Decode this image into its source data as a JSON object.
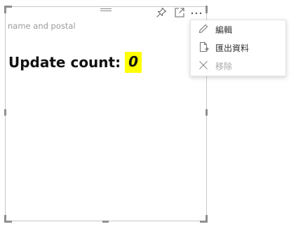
{
  "visual": {
    "title": "name and postal",
    "count_label": "Update count:",
    "count_value": "0",
    "highlight_color": "#ffff00"
  },
  "header_icons": [
    "drag-grip-icon",
    "pin-icon",
    "focus-mode-icon",
    "more-options-icon"
  ],
  "context_menu": {
    "items": [
      {
        "label": "編輯",
        "icon": "pencil-icon",
        "enabled": true
      },
      {
        "label": "匯出資料",
        "icon": "export-data-icon",
        "enabled": true
      },
      {
        "label": "移除",
        "icon": "close-icon",
        "enabled": false
      }
    ]
  }
}
